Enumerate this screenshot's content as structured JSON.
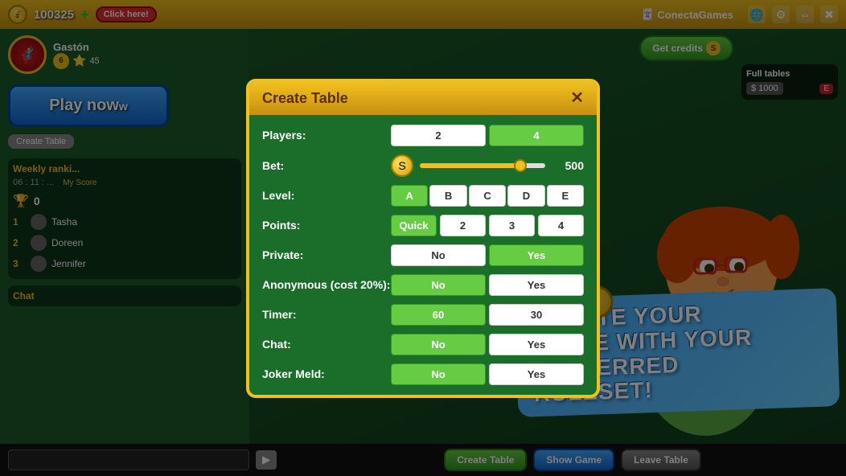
{
  "topbar": {
    "coin_icon": "💰",
    "score": "100325",
    "plus_icon": "+",
    "click_label": "Click here!",
    "logo": "ConectaGames",
    "icons": [
      "🃏",
      "🌐",
      "⚙",
      "✖",
      "✖"
    ]
  },
  "user": {
    "name": "Gastón",
    "level": "6",
    "score": "45"
  },
  "buttons": {
    "play_now": "Play now",
    "create_table_small": "Create Table",
    "get_credits": "Get credits"
  },
  "rankings": {
    "title": "Weekly ranki...",
    "time": "06 : 11 : ...",
    "my_score_label": "My Score",
    "current_rank": "0",
    "entries": [
      {
        "rank": "1",
        "name": "Tasha"
      },
      {
        "rank": "2",
        "name": "Doreen"
      },
      {
        "rank": "3",
        "name": "Jennifer"
      }
    ]
  },
  "chat": {
    "title": "Chat"
  },
  "full_tables": {
    "title": "Full tables",
    "rows": [
      {
        "amount": "$ 1000",
        "badge": "E"
      }
    ]
  },
  "modal": {
    "title": "Create Table",
    "close_icon": "✕",
    "rows": [
      {
        "label": "Players:",
        "type": "options",
        "options": [
          "2",
          "4"
        ],
        "active": "4"
      },
      {
        "label": "Bet:",
        "type": "bet",
        "value": "500"
      },
      {
        "label": "Level:",
        "type": "options",
        "options": [
          "A",
          "B",
          "C",
          "D",
          "E"
        ],
        "active": "A"
      },
      {
        "label": "Points:",
        "type": "options",
        "options": [
          "Quick",
          "2",
          "3",
          "4"
        ],
        "active": "Quick"
      },
      {
        "label": "Private:",
        "type": "options",
        "options": [
          "No",
          "Yes"
        ],
        "active": "Yes"
      },
      {
        "label": "Anonymous (cost 20%):",
        "type": "options",
        "options": [
          "No",
          "Yes"
        ],
        "active": "No"
      },
      {
        "label": "Timer:",
        "type": "options",
        "options": [
          "60",
          "30"
        ],
        "active": "60"
      },
      {
        "label": "Chat:",
        "type": "options",
        "options": [
          "No",
          "Yes"
        ],
        "active": "No"
      },
      {
        "label": "Joker Meld:",
        "type": "options",
        "options": [
          "No",
          "Yes"
        ],
        "active": "No"
      }
    ]
  },
  "promo": {
    "line1": "CREATE YOUR",
    "line2": "TABLE WITH YOUR",
    "line3": "PREFERRED",
    "line4": "RULESET!"
  },
  "bottom_bar": {
    "create_table": "Create Table",
    "show_game": "Show Game",
    "leave_table": "Leave Table",
    "send_icon": "▶"
  }
}
